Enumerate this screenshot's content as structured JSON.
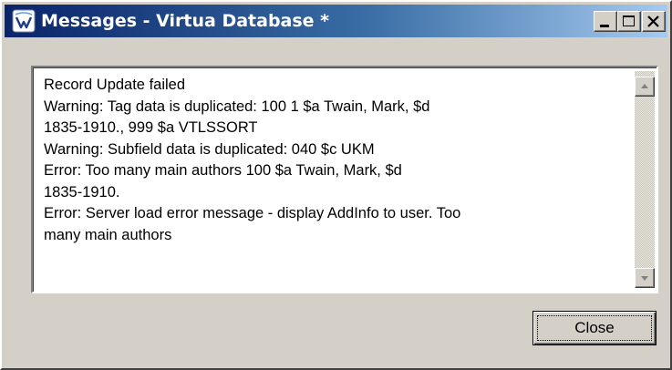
{
  "window": {
    "title": "Messages - Virtua Database *",
    "icon": "virtua-app-icon",
    "controls": [
      "minimize-icon",
      "maximize-icon",
      "close-icon"
    ]
  },
  "messages": {
    "lines": [
      "Record Update failed",
      "Warning: Tag data is duplicated:  100 1  $a Twain, Mark, $d",
      "1835-1910., 999   $a VTLSSORT",
      "Warning: Subfield data is duplicated:  040 $c UKM",
      "Error: Too many main authors 100  $a Twain, Mark, $d",
      "1835-1910.",
      "Error: Server load error message - display AddInfo to user. Too",
      "many main authors"
    ]
  },
  "buttons": {
    "close_label": "Close"
  },
  "colors": {
    "title_bar_start": "#0a246a",
    "title_bar_end": "#a6caf0",
    "face": "#d4d0c8"
  }
}
